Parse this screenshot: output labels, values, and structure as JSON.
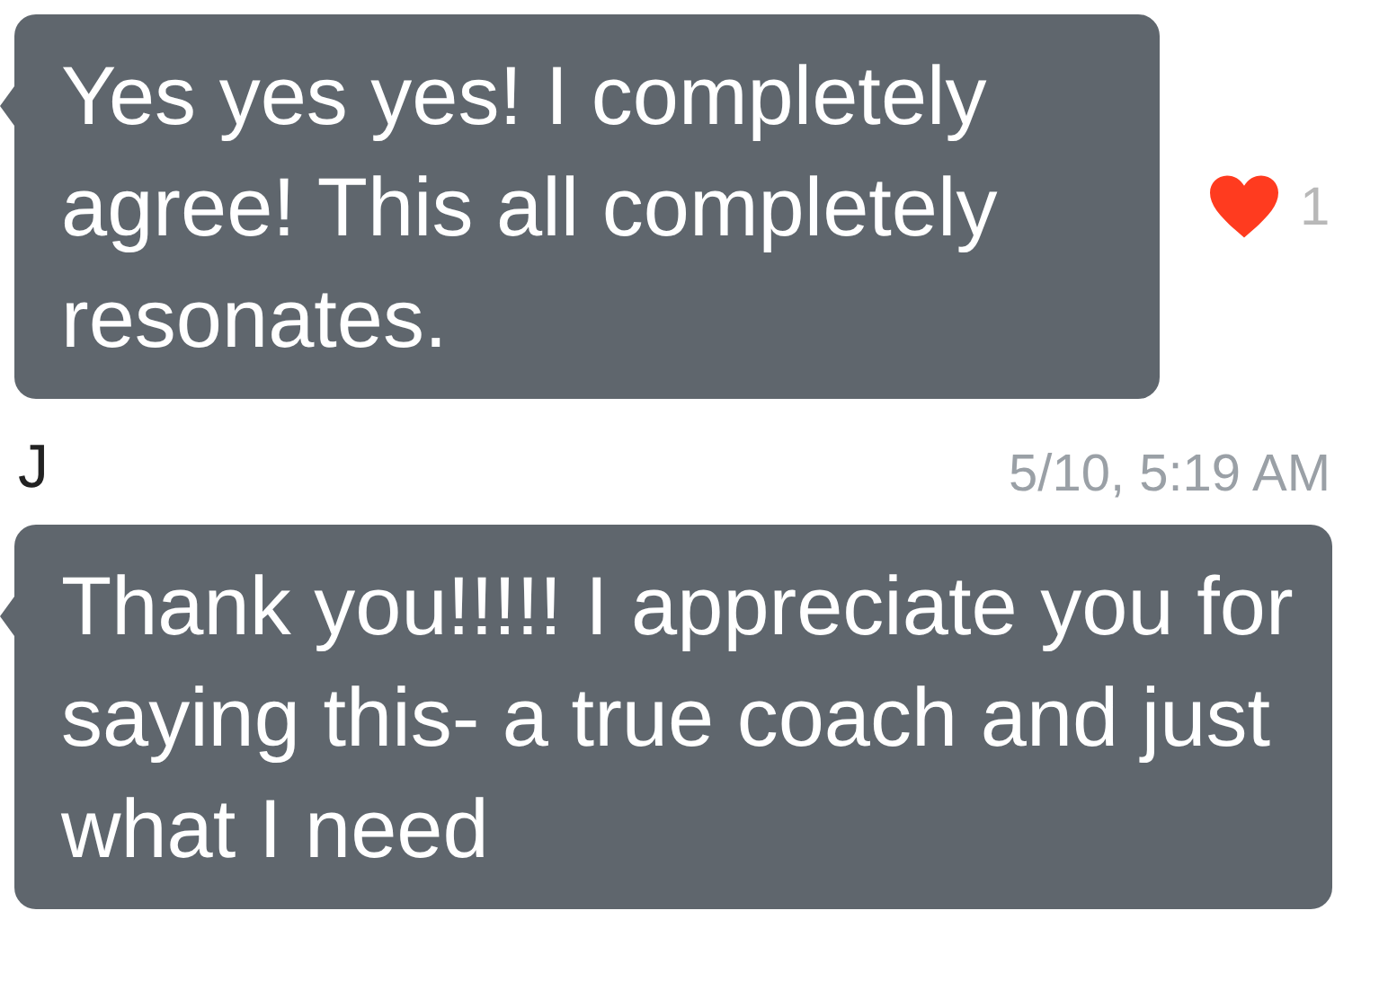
{
  "messages": [
    {
      "text": "Yes yes yes! I completely agree! This all completely resonates.",
      "reaction": {
        "liked": true,
        "count": "1"
      }
    },
    {
      "sender": "J",
      "time": "5/10, 5:19 AM",
      "text": "Thank you!!!!! I appreciate you for saying this- a true coach and just what I need"
    }
  ]
}
